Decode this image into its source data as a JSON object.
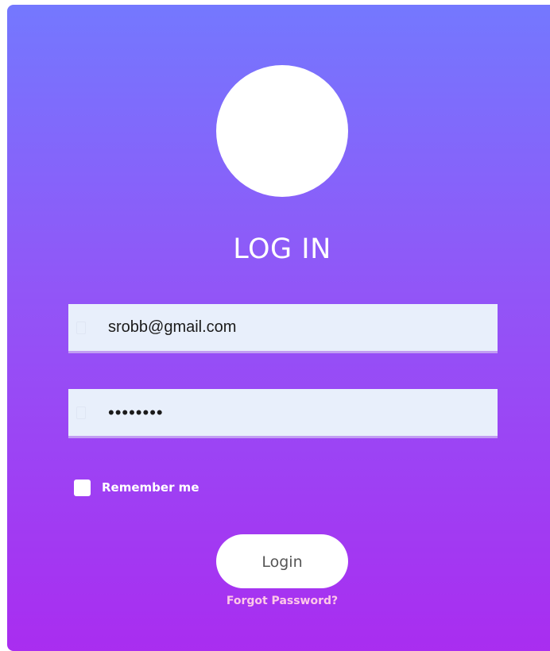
{
  "login_form": {
    "title": "LOG IN",
    "avatar_icon": "user-avatar-placeholder",
    "email": {
      "value": "srobb@gmail.com",
      "icon": "envelope-icon"
    },
    "password": {
      "value": "••••••••",
      "icon": "lock-icon"
    },
    "remember_me": {
      "label": "Remember me",
      "checked": false
    },
    "login_button_label": "Login",
    "forgot_password_label": "Forgot Password?"
  },
  "colors": {
    "gradient_top": "#7478fe",
    "gradient_bottom": "#a92df0",
    "input_background": "#e8effb",
    "input_underline": "#c19df2",
    "forgot_link": "#ffc8e8"
  }
}
